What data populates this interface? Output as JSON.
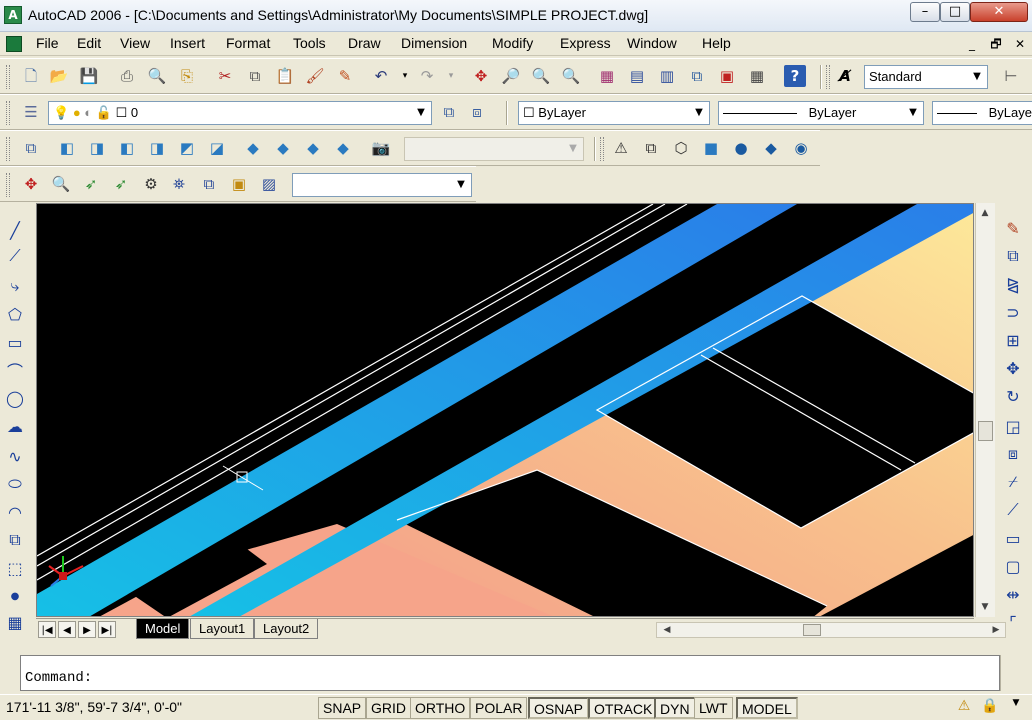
{
  "window": {
    "app_icon_glyph": "A",
    "title": "AutoCAD 2006 - [C:\\Documents and Settings\\Administrator\\My Documents\\SIMPLE PROJECT.dwg]",
    "minimize": "–",
    "maximize": "□",
    "close": "✕"
  },
  "menubar": {
    "items": [
      "File",
      "Edit",
      "View",
      "Insert",
      "Format",
      "Tools",
      "Draw",
      "Dimension",
      "Modify",
      "Express",
      "Window",
      "Help"
    ],
    "doc_controls": [
      "_",
      "🗗",
      "✕"
    ]
  },
  "standard_toolbar": {
    "text_style_icon": "A̸",
    "text_style": "Standard"
  },
  "layers_toolbar": {
    "layer_name": "0",
    "color": "ByLayer",
    "linetype": "ByLayer",
    "lineweight": "ByLayer"
  },
  "tabs": {
    "model": "Model",
    "layout1": "Layout1",
    "layout2": "Layout2",
    "nav": [
      "|◀",
      "◀",
      "▶",
      "▶|"
    ]
  },
  "command": {
    "prompt": "Command:"
  },
  "status": {
    "coords": "171'-11 3/8\", 59'-7 3/4\", 0'-0\"",
    "buttons": [
      {
        "label": "SNAP",
        "on": false
      },
      {
        "label": "GRID",
        "on": false
      },
      {
        "label": "ORTHO",
        "on": false
      },
      {
        "label": "POLAR",
        "on": false
      },
      {
        "label": "OSNAP",
        "on": true
      },
      {
        "label": "OTRACK",
        "on": true
      },
      {
        "label": "DYN",
        "on": true
      },
      {
        "label": "LWT",
        "on": false
      },
      {
        "label": "MODEL",
        "on": true
      }
    ]
  },
  "colors": {
    "drawing_bg": "#000000",
    "beam_blue": "#1cb0e8",
    "slab_salmon": "#f4a98a",
    "slab_yellow": "#fbe79a"
  }
}
